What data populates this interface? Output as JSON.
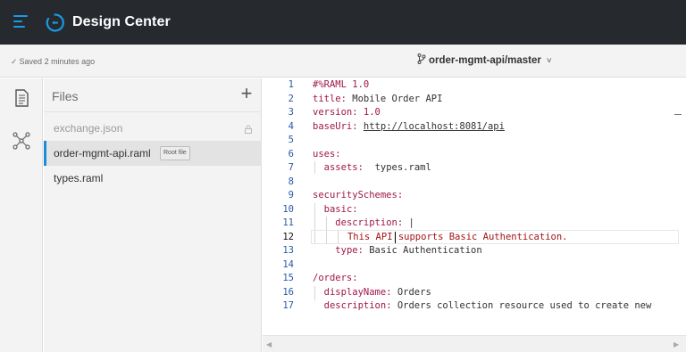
{
  "app": {
    "title": "Design Center",
    "accent_color": "#1a9ae6",
    "topbar_color": "#262a2f"
  },
  "status": {
    "saved_text": "Saved 2 minutes ago",
    "branch": "order-mgmt-api/master"
  },
  "rail": {
    "items": [
      {
        "icon": "file-icon"
      },
      {
        "icon": "api-graph-icon"
      }
    ]
  },
  "files": {
    "title": "Files",
    "add_label": "+",
    "items": [
      {
        "name": "exchange.json",
        "locked": true
      },
      {
        "name": "order-mgmt-api.raml",
        "badge": "Root file",
        "active": true
      },
      {
        "name": "types.raml"
      }
    ]
  },
  "editor": {
    "current_line": 12,
    "lines": [
      {
        "n": "1"
      },
      {
        "n": "2"
      },
      {
        "n": "3"
      },
      {
        "n": "4"
      },
      {
        "n": "5"
      },
      {
        "n": "6"
      },
      {
        "n": "7"
      },
      {
        "n": "8"
      },
      {
        "n": "9"
      },
      {
        "n": "10"
      },
      {
        "n": "11"
      },
      {
        "n": "12"
      },
      {
        "n": "13"
      },
      {
        "n": "14"
      },
      {
        "n": "15"
      },
      {
        "n": "16"
      },
      {
        "n": "17"
      }
    ],
    "code": {
      "l1": "#%RAML 1.0",
      "l2_key": "title:",
      "l2_val": " Mobile Order API",
      "l3_key": "version:",
      "l3_val": " 1.0",
      "l4_key": "baseUri:",
      "l4_url": "http://localhost:8081/api",
      "l6_key": "uses:",
      "l7_key": "assets:",
      "l7_val": "  types.raml",
      "l9_key": "securitySchemes:",
      "l10_key": "basic:",
      "l11_key": "description:",
      "l11_val": " |",
      "l12_a": "This API",
      "l12_b": " supports Basic Authentication.",
      "l13_key": "type:",
      "l13_val": " Basic Authentication",
      "l15_key": "/orders:",
      "l16_key": "displayName:",
      "l16_val": " Orders",
      "l17_key": "description:",
      "l17_val": " Orders collection resource used to create new"
    }
  },
  "scrollbar": {
    "left_arrow": "◀",
    "right_arrow": "▶"
  }
}
